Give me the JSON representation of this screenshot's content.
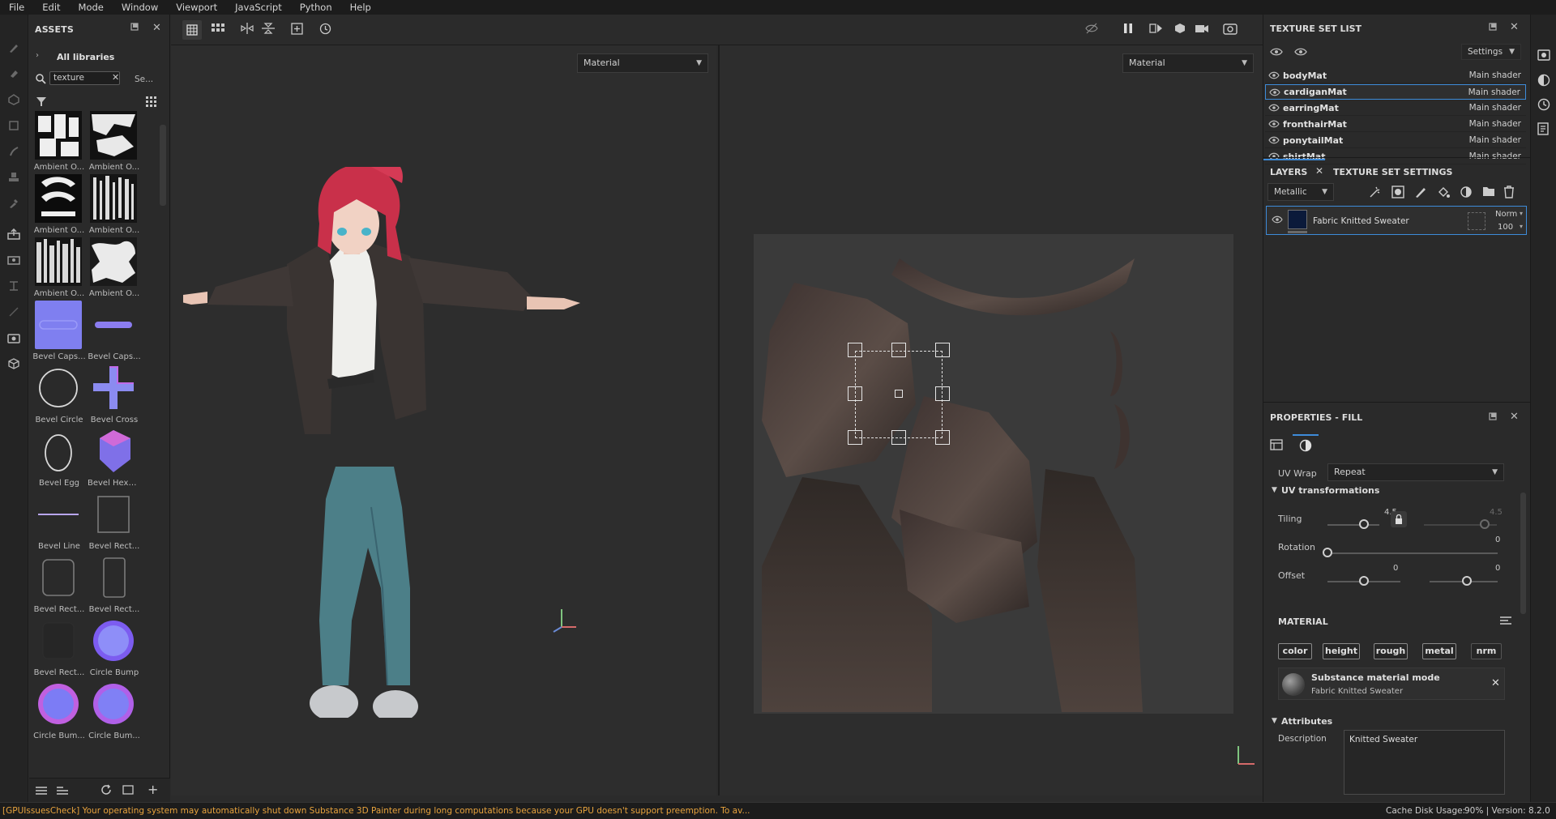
{
  "menu": [
    "File",
    "Edit",
    "Mode",
    "Window",
    "Viewport",
    "JavaScript",
    "Python",
    "Help"
  ],
  "assets": {
    "title": "ASSETS",
    "library": "All libraries",
    "search_value": "texture",
    "search_extra": "Se...",
    "items": [
      {
        "label": "Ambient O...",
        "kind": "bw1"
      },
      {
        "label": "Ambient O...",
        "kind": "bw2"
      },
      {
        "label": "Ambient O...",
        "kind": "bw3"
      },
      {
        "label": "Ambient O...",
        "kind": "bw4"
      },
      {
        "label": "Ambient O...",
        "kind": "bw5"
      },
      {
        "label": "Ambient O...",
        "kind": "bw6"
      },
      {
        "label": "Bevel Caps...",
        "kind": "capsule-tile"
      },
      {
        "label": "Bevel Caps...",
        "kind": "capsule-line"
      },
      {
        "label": "Bevel Circle",
        "kind": "circle"
      },
      {
        "label": "Bevel Cross",
        "kind": "cross"
      },
      {
        "label": "Bevel Egg",
        "kind": "egg"
      },
      {
        "label": "Bevel Hexa...",
        "kind": "hexa"
      },
      {
        "label": "Bevel Line",
        "kind": "line"
      },
      {
        "label": "Bevel Rect...",
        "kind": "rect"
      },
      {
        "label": "Bevel Rect...",
        "kind": "rect-round"
      },
      {
        "label": "Bevel Rect...",
        "kind": "rect-tall"
      },
      {
        "label": "Bevel Rect...",
        "kind": "rect-dark"
      },
      {
        "label": "Circle Bump",
        "kind": "bump"
      },
      {
        "label": "Circle Bum...",
        "kind": "bump2"
      },
      {
        "label": "Circle Bum...",
        "kind": "bump3"
      }
    ]
  },
  "viewport3d": {
    "mode": "Material"
  },
  "viewport2d": {
    "mode": "Material"
  },
  "texture_set_list": {
    "title": "TEXTURE SET LIST",
    "settings_label": "Settings",
    "items": [
      {
        "name": "bodyMat",
        "shader": "Main shader",
        "selected": false
      },
      {
        "name": "cardiganMat",
        "shader": "Main shader",
        "selected": true
      },
      {
        "name": "earringMat",
        "shader": "Main shader",
        "selected": false
      },
      {
        "name": "fronthairMat",
        "shader": "Main shader",
        "selected": false
      },
      {
        "name": "ponytailMat",
        "shader": "Main shader",
        "selected": false
      },
      {
        "name": "shirtMat",
        "shader": "Main shader",
        "selected": false
      }
    ]
  },
  "layers": {
    "tab_layers": "LAYERS",
    "tab_tss": "TEXTURE SET SETTINGS",
    "channel": "Metallic",
    "layer": {
      "name": "Fabric Knitted Sweater",
      "blend": "Norm",
      "opacity": "100"
    }
  },
  "properties": {
    "title": "PROPERTIES - FILL",
    "uv_wrap_label": "UV Wrap",
    "uv_wrap_value": "Repeat",
    "uv_transform_title": "UV transformations",
    "tiling_label": "Tiling",
    "tiling_value": "4.5",
    "tiling_value_2": "4.5",
    "tiling_zero": "0",
    "tiling_fraction": 0.35,
    "rotation_label": "Rotation",
    "rotation_value": "0",
    "offset_label": "Offset",
    "offset_value_1": "0",
    "offset_value_2": "0",
    "material_title": "MATERIAL",
    "chips": [
      "color",
      "height",
      "rough",
      "metal",
      "nrm"
    ],
    "substance_title": "Substance material mode",
    "substance_sub": "Fabric Knitted Sweater",
    "attributes_title": "Attributes",
    "description_label": "Description",
    "description_value": "Knitted Sweater"
  },
  "status": {
    "message": "[GPUIssuesCheck] Your operating system may automatically shut down Substance 3D Painter during long computations because your GPU doesn't support preemption. To av...",
    "cache": "Cache Disk Usage:",
    "cache_value": "90% | Version: 8.2.0"
  },
  "colors": {
    "accent": "#3d8bd9",
    "warning": "#e8a33d",
    "bg": "#2b2b2b"
  }
}
